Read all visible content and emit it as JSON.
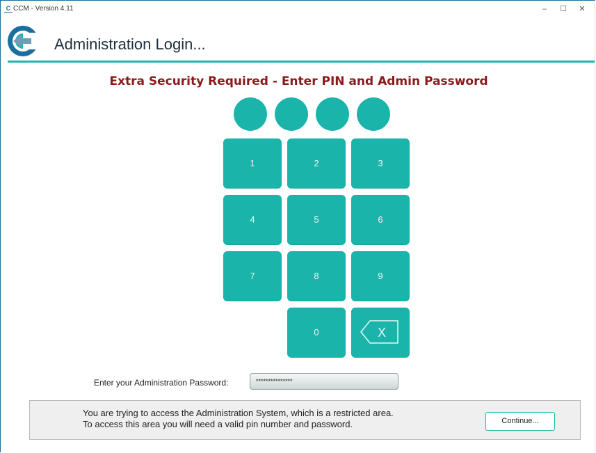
{
  "window": {
    "app_icon": "C",
    "title": "CCM - Version 4.11",
    "controls": {
      "minimize": "–",
      "maximize": "☐",
      "close": "✕"
    }
  },
  "header": {
    "logo_icon": "ccm-logo-icon",
    "title": "Administration Login..."
  },
  "security": {
    "title": "Extra Security Required - Enter PIN and Admin Password",
    "pin_dot_count": 4
  },
  "keypad": {
    "keys": [
      "1",
      "2",
      "3",
      "4",
      "5",
      "6",
      "7",
      "8",
      "9",
      "0"
    ],
    "backspace_glyph": "X"
  },
  "password": {
    "label": "Enter your Administration Password:",
    "value": "***************"
  },
  "info": {
    "line1": "You are trying to access the Administration System, which is a restricted area.",
    "line2": "To access this area you will need a valid pin number and password.",
    "continue_label": "Continue..."
  },
  "colors": {
    "accent": "#1ab4aa",
    "title_red": "#8b1a1a",
    "logo_blue": "#1a6f9e"
  }
}
